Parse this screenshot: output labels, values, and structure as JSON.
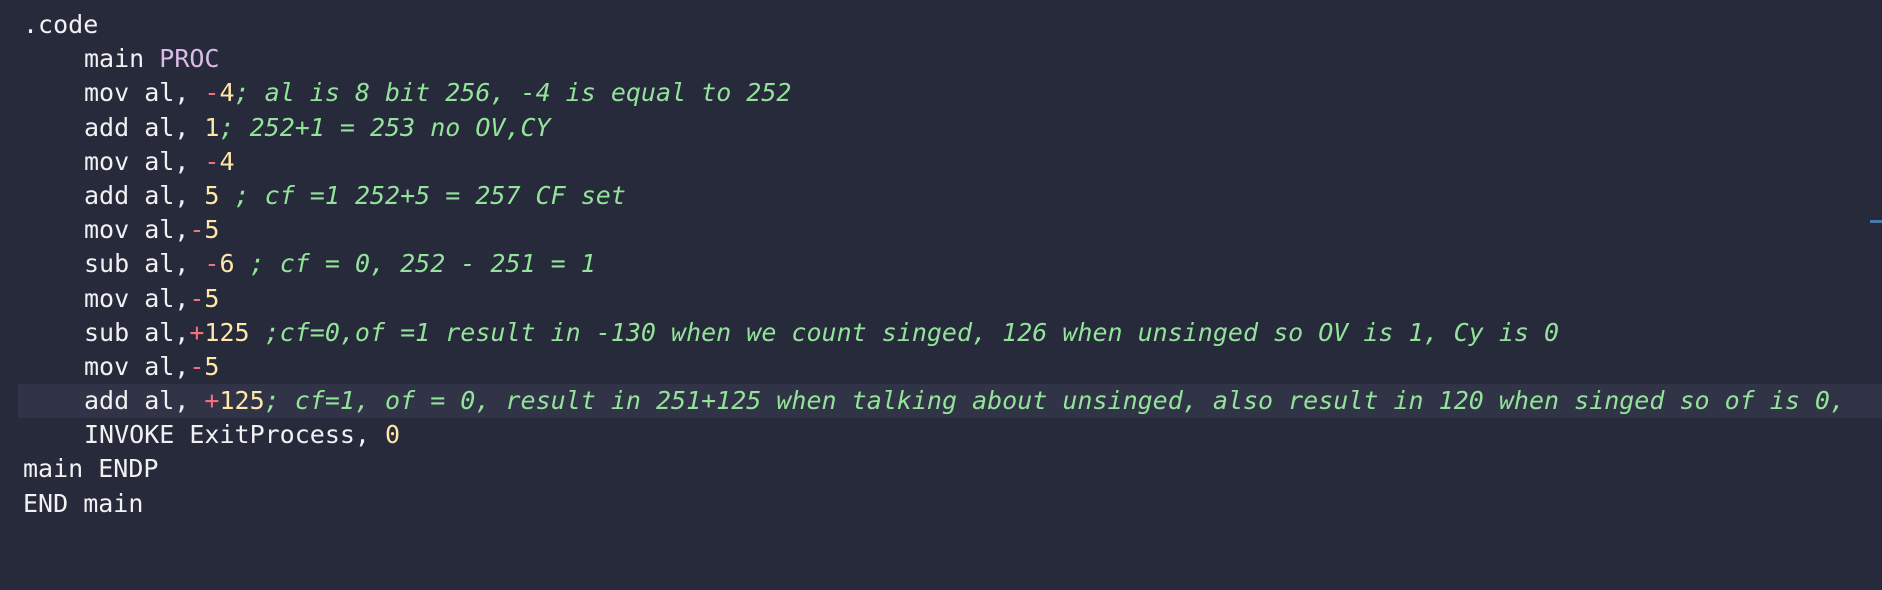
{
  "editor": {
    "lines": [
      {
        "segments": [
          {
            "t": ".code",
            "c": "txt"
          }
        ]
      },
      {
        "segments": [
          {
            "t": "main ",
            "c": "txt"
          },
          {
            "t": "PROC",
            "c": "kw"
          }
        ]
      },
      {
        "segments": [
          {
            "t": "mov al, ",
            "c": "txt"
          },
          {
            "t": "-",
            "c": "sign"
          },
          {
            "t": "4",
            "c": "num"
          },
          {
            "t": "; al is 8 bit 256, -4 is equal to 252",
            "c": "cmt"
          }
        ]
      },
      {
        "segments": [
          {
            "t": "add al, ",
            "c": "txt"
          },
          {
            "t": "1",
            "c": "num"
          },
          {
            "t": "; 252+1 = 253 no OV,CY",
            "c": "cmt"
          }
        ]
      },
      {
        "segments": [
          {
            "t": "mov al, ",
            "c": "txt"
          },
          {
            "t": "-",
            "c": "sign"
          },
          {
            "t": "4",
            "c": "num"
          }
        ]
      },
      {
        "segments": [
          {
            "t": "add al, ",
            "c": "txt"
          },
          {
            "t": "5",
            "c": "num"
          },
          {
            "t": " ; cf =1 252+5 = 257 CF set",
            "c": "cmt"
          }
        ]
      },
      {
        "segments": [
          {
            "t": "mov al,",
            "c": "txt"
          },
          {
            "t": "-",
            "c": "sign"
          },
          {
            "t": "5",
            "c": "num"
          }
        ]
      },
      {
        "segments": [
          {
            "t": "sub al, ",
            "c": "txt"
          },
          {
            "t": "-",
            "c": "sign"
          },
          {
            "t": "6",
            "c": "num"
          },
          {
            "t": " ; cf = 0, 252 - 251 = 1",
            "c": "cmt"
          }
        ]
      },
      {
        "segments": [
          {
            "t": "mov al,",
            "c": "txt"
          },
          {
            "t": "-",
            "c": "sign"
          },
          {
            "t": "5",
            "c": "num"
          }
        ]
      },
      {
        "segments": [
          {
            "t": "sub al,",
            "c": "txt"
          },
          {
            "t": "+",
            "c": "sign"
          },
          {
            "t": "125",
            "c": "num"
          },
          {
            "t": " ;cf=0,of =1 result in -130 when we count singed, 126 when unsinged so OV is 1, Cy is 0",
            "c": "cmt"
          }
        ]
      },
      {
        "segments": [
          {
            "t": "mov al,",
            "c": "txt"
          },
          {
            "t": "-",
            "c": "sign"
          },
          {
            "t": "5",
            "c": "num"
          }
        ]
      },
      {
        "segments": [
          {
            "t": "add al, ",
            "c": "txt"
          },
          {
            "t": "+",
            "c": "sign"
          },
          {
            "t": "125",
            "c": "num"
          },
          {
            "t": "; cf=1, of = 0, result in 251+125 when talking about unsinged, also result in 120 when singed so of is 0,",
            "c": "cmt"
          }
        ]
      },
      {
        "segments": [
          {
            "t": "INVOKE ExitProcess, ",
            "c": "txt"
          },
          {
            "t": "0",
            "c": "num"
          }
        ]
      },
      {
        "segments": [
          {
            "t": "main ENDP",
            "c": "txt"
          }
        ]
      },
      {
        "segments": [
          {
            "t": "END main",
            "c": "txt"
          }
        ]
      }
    ]
  }
}
